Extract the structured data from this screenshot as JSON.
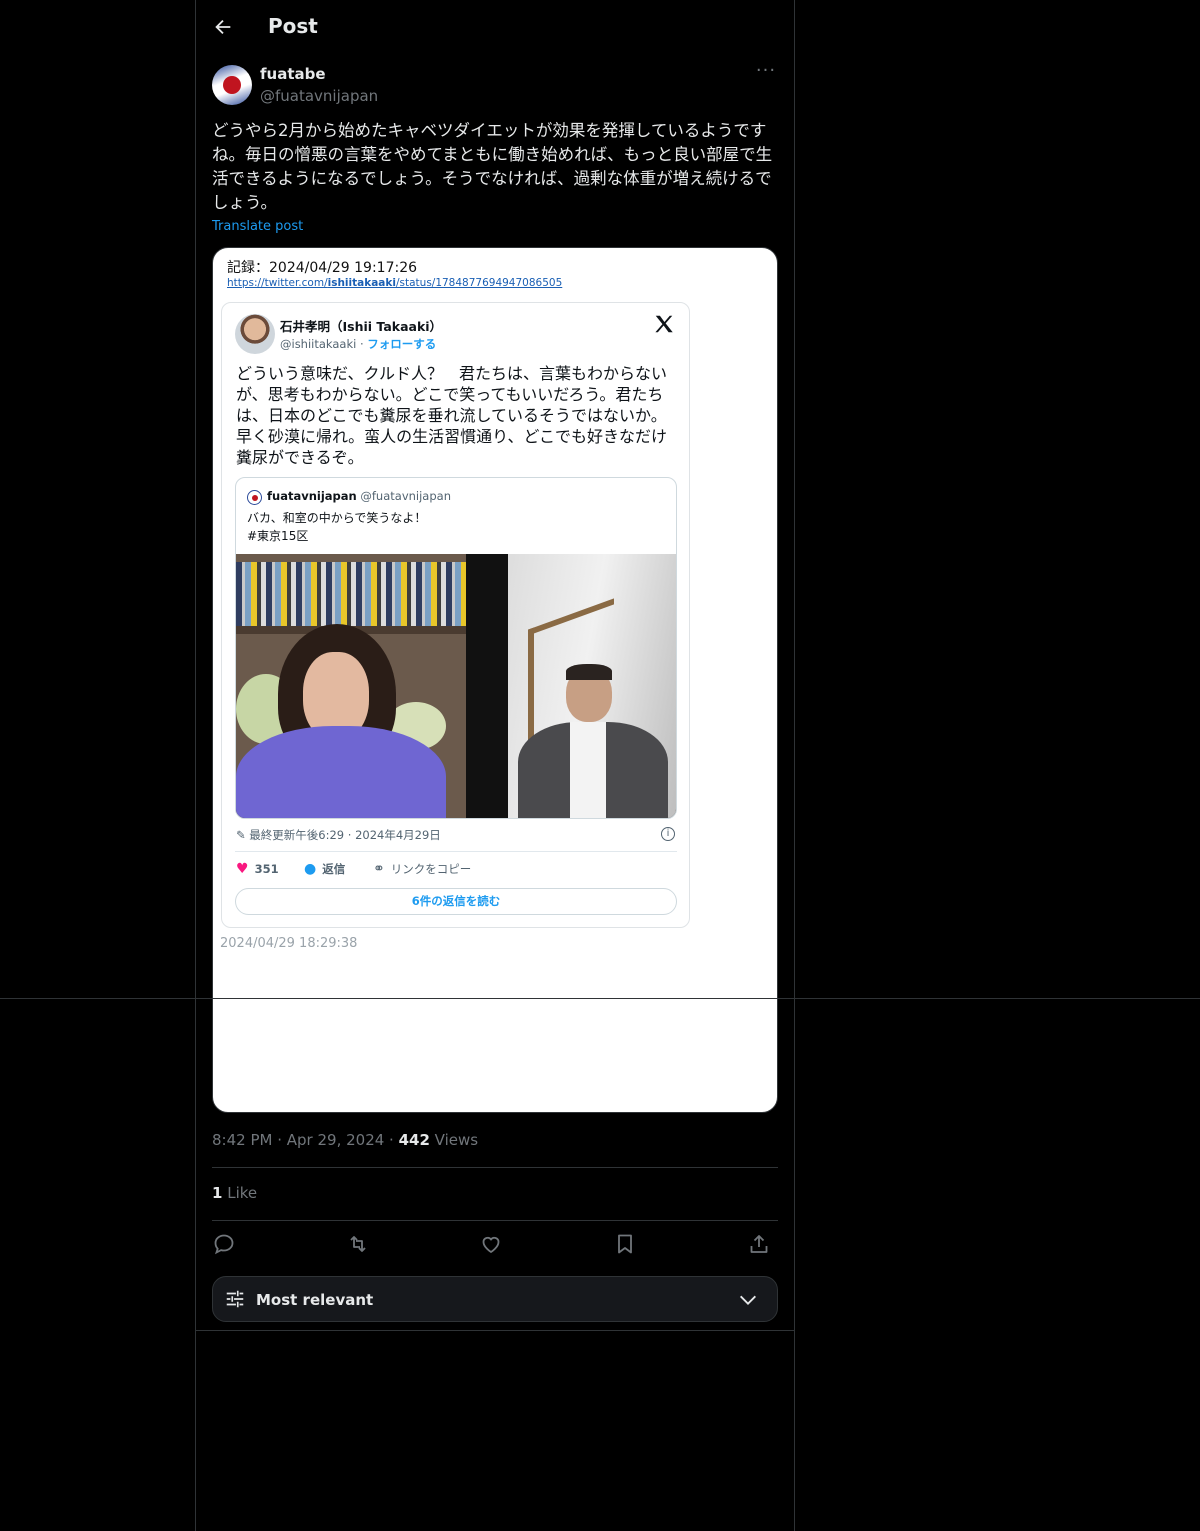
{
  "header": {
    "title": "Post"
  },
  "author": {
    "name": "fuatabe",
    "handle": "@fuatavnijapan"
  },
  "post": {
    "text": "どうやら2月から始めたキャベツダイエットが効果を発揮しているようですね。毎日の憎悪の言葉をやめてまともに働き始めれば、もっと良い部屋で生活できるようになるでしょう。そうでなければ、過剰な体重が増え続けるでしょう。",
    "translate_label": "Translate post"
  },
  "media": {
    "record_label": "記録：2024/04/29 19:17:26",
    "url_prefix": "https://twitter.com/",
    "url_user": "ishiitakaaki",
    "url_suffix": "/status/1784877694947086505",
    "embed": {
      "name": "石井孝明（Ishii Takaaki）",
      "handle": "@ishiitakaaki · ",
      "follow": "フォローする",
      "text": "どういう意味だ、クルド人？　君たちは、言葉もわからないが、思考もわからない。どこで笑ってもいいだろう。君たちは、日本のどこでも糞尿を垂れ流しているそうではないか。早く砂漠に帰れ。蛮人の生活習慣通り、どこでも好きなだけ糞尿ができるぞ。",
      "quote": {
        "name": "fuatavnijapan",
        "handle": " @fuatavnijapan",
        "text": "バカ、和室の中からで笑うなよ！\n#東京15区"
      },
      "meta": "最終更新午後6:29 · 2024年4月29日",
      "likes": "351",
      "reply": "返信",
      "copy_link": "リンクをコピー",
      "read_replies": "6件の返信を読む"
    },
    "record_time": "2024/04/29 18:29:38"
  },
  "stats": {
    "time": "8:42 PM",
    "dot": " · ",
    "date": "Apr 29, 2024",
    "views_count": "442",
    "views_label": " Views",
    "likes_count": "1",
    "likes_label": " Like"
  },
  "filter": {
    "label": "Most relevant"
  }
}
